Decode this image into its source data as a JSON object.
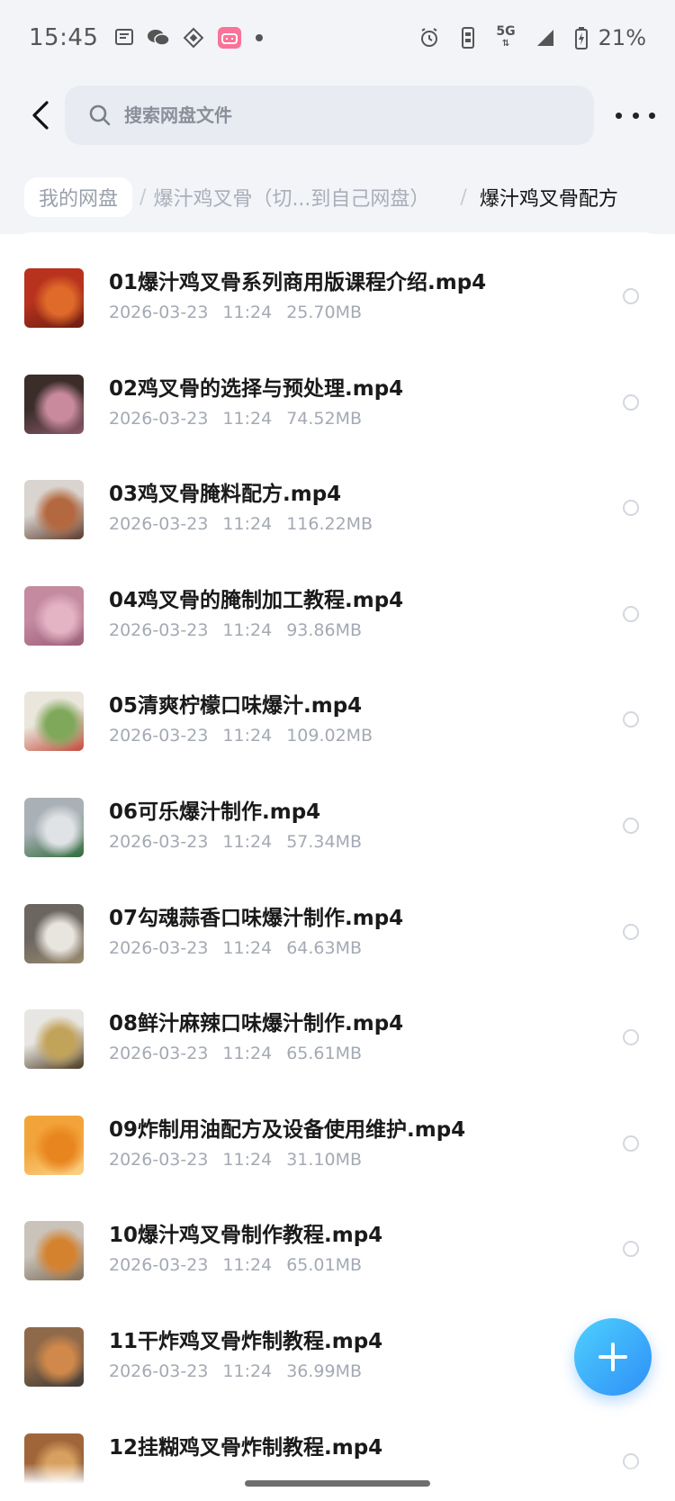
{
  "status_bar": {
    "time": "15:45",
    "network": "5G",
    "battery_percent": "21%",
    "left_icons": [
      "message-icon",
      "wechat-icon",
      "diamond-app-icon",
      "bilibili-icon",
      "dot-icon"
    ],
    "right_icons": [
      "alarm-icon",
      "vibrate-icon",
      "5g-icon",
      "signal-icon",
      "battery-charging-icon"
    ]
  },
  "header": {
    "search_placeholder": "搜索网盘文件"
  },
  "breadcrumb": {
    "home": "我的网盘",
    "middle": "爆汁鸡叉骨（切...到自己网盘）",
    "current": "爆汁鸡叉骨配方"
  },
  "files": [
    {
      "name": "01爆汁鸡叉骨系列商用版课程介绍.mp4",
      "date": "2026-03-23",
      "time": "11:24",
      "size": "25.70MB",
      "thumb_colors": [
        "#b8321d",
        "#e06a2a",
        "#6b1e12"
      ]
    },
    {
      "name": "02鸡叉骨的选择与预处理.mp4",
      "date": "2026-03-23",
      "time": "11:24",
      "size": "74.52MB",
      "thumb_colors": [
        "#3a2d2a",
        "#c98a9e",
        "#8a5868"
      ]
    },
    {
      "name": "03鸡叉骨腌料配方.mp4",
      "date": "2026-03-23",
      "time": "11:24",
      "size": "116.22MB",
      "thumb_colors": [
        "#d9d4cf",
        "#b4683f",
        "#5a3a2c"
      ]
    },
    {
      "name": "04鸡叉骨的腌制加工教程.mp4",
      "date": "2026-03-23",
      "time": "11:24",
      "size": "93.86MB",
      "thumb_colors": [
        "#c48aa0",
        "#e4b3c4",
        "#9c5f78"
      ]
    },
    {
      "name": "05清爽柠檬口味爆汁.mp4",
      "date": "2026-03-23",
      "time": "11:24",
      "size": "109.02MB",
      "thumb_colors": [
        "#eae6dc",
        "#7fa85a",
        "#c44a3c"
      ]
    },
    {
      "name": "06可乐爆汁制作.mp4",
      "date": "2026-03-23",
      "time": "11:24",
      "size": "57.34MB",
      "thumb_colors": [
        "#a9b0b6",
        "#dfe3e6",
        "#2f6b3a"
      ]
    },
    {
      "name": "07勾魂蒜香口味爆汁制作.mp4",
      "date": "2026-03-23",
      "time": "11:24",
      "size": "64.63MB",
      "thumb_colors": [
        "#6b6660",
        "#e8e4de",
        "#9a8a6e"
      ]
    },
    {
      "name": "08鲜汁麻辣口味爆汁制作.mp4",
      "date": "2026-03-23",
      "time": "11:24",
      "size": "65.61MB",
      "thumb_colors": [
        "#e8e6e2",
        "#c2a35a",
        "#4a3a22"
      ]
    },
    {
      "name": "09炸制用油配方及设备使用维护.mp4",
      "date": "2026-03-23",
      "time": "11:24",
      "size": "31.10MB",
      "thumb_colors": [
        "#f2a43a",
        "#e9851e",
        "#fbd38a"
      ]
    },
    {
      "name": "10爆汁鸡叉骨制作教程.mp4",
      "date": "2026-03-23",
      "time": "11:24",
      "size": "65.01MB",
      "thumb_colors": [
        "#c9c3ba",
        "#d5822f",
        "#7d6a55"
      ]
    },
    {
      "name": "11干炸鸡叉骨炸制教程.mp4",
      "date": "2026-03-23",
      "time": "11:24",
      "size": "36.99MB",
      "thumb_colors": [
        "#8f6a4a",
        "#d0894a",
        "#3e3a36"
      ]
    },
    {
      "name": "12挂糊鸡叉骨炸制教程.mp4",
      "date": "",
      "time": "",
      "size": "",
      "thumb_colors": [
        "#a0663a",
        "#d8a060",
        "#4a2e1c"
      ]
    }
  ],
  "fab": {
    "icon": "plus-icon"
  },
  "colors": {
    "accent": "#2d8ff6",
    "accent_light": "#4fd0ff",
    "text_primary": "#1a1a1a",
    "text_secondary": "#a4a9b3"
  }
}
